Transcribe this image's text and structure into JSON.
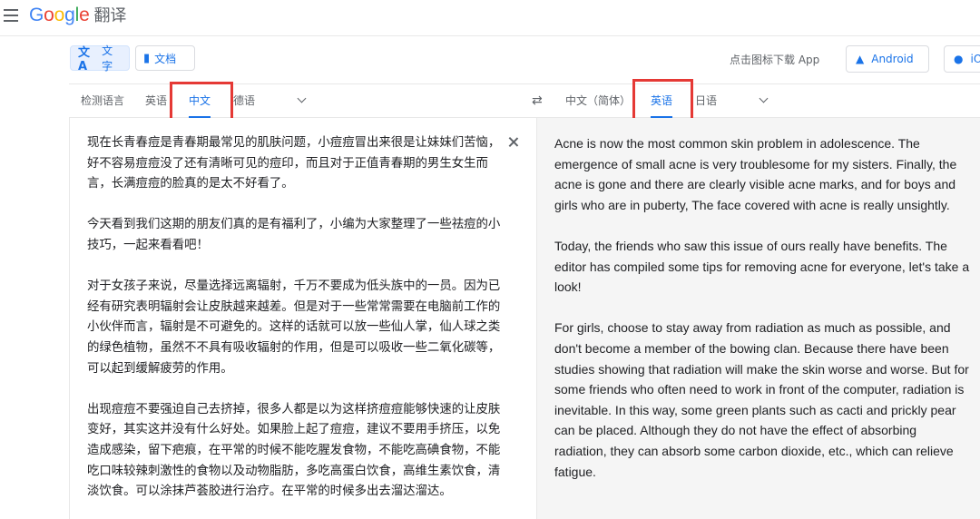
{
  "header": {
    "logo_letters": [
      "G",
      "o",
      "o",
      "g",
      "l",
      "e"
    ],
    "product": "翻译"
  },
  "modes": {
    "text_label": "文字",
    "doc_label": "文档",
    "text_icon": "translate-icon",
    "doc_icon": "document-icon"
  },
  "apps": {
    "download_text": "点击图标下载 App",
    "android_label": "Android",
    "ios_label": "iO"
  },
  "source_langs": {
    "detect": "检测语言",
    "items": [
      "英语",
      "中文",
      "德语"
    ],
    "active": "中文"
  },
  "target_langs": {
    "items": [
      "中文（简体）",
      "英语",
      "日语"
    ],
    "active": "英语"
  },
  "source": {
    "text": "现在长青春痘是青春期最常见的肌肤问题，小痘痘冒出来很是让妹妹们苦恼，好不容易痘痘没了还有清晰可见的痘印，而且对于正值青春期的男生女生而言，长满痘痘的脸真的是太不好看了。\n\n今天看到我们这期的朋友们真的是有福利了，小编为大家整理了一些祛痘的小技巧，一起来看看吧！\n\n对于女孩子来说，尽量选择远离辐射，千万不要成为低头族中的一员。因为已经有研究表明辐射会让皮肤越来越差。但是对于一些常常需要在电脑前工作的小伙伴而言，辐射是不可避免的。这样的话就可以放一些仙人掌，仙人球之类的绿色植物，虽然不不具有吸收辐射的作用，但是可以吸收一些二氧化碳等，可以起到缓解疲劳的作用。\n\n出现痘痘不要强迫自己去挤掉，很多人都是以为这样挤痘痘能够快速的让皮肤变好，其实这并没有什么好处。如果脸上起了痘痘，建议不要用手挤压，以免造成感染，留下疤痕，在平常的时候不能吃腥发食物，不能吃高碘食物，不能吃口味较辣刺激性的食物以及动物脂肪，多吃高蛋白饮食，高维生素饮食，清淡饮食。可以涂抹芦荟胶进行治疗。在平常的时候多出去溜达溜达。"
  },
  "target": {
    "text": "Acne is now the most common skin problem in adolescence. The emergence of small acne is very troublesome for my sisters. Finally, the acne is gone and there are clearly visible acne marks, and for boys and girls who are in puberty, The face covered with acne is really unsightly.\n\nToday, the friends who saw this issue of ours really have benefits. The editor has compiled some tips for removing acne for everyone, let's take a look!\n\nFor girls, choose to stay away from radiation as much as possible, and don't become a member of the bowing clan. Because there have been studies showing that radiation will make the skin worse and worse. But for some friends who often need to work in front of the computer, radiation is inevitable. In this way, some green plants such as cacti and prickly pear can be placed. Although they do not have the effect of absorbing radiation, they can absorb some carbon dioxide, etc., which can relieve fatigue."
  },
  "colors": {
    "accent": "#1a73e8",
    "highlight": "#e53935"
  }
}
